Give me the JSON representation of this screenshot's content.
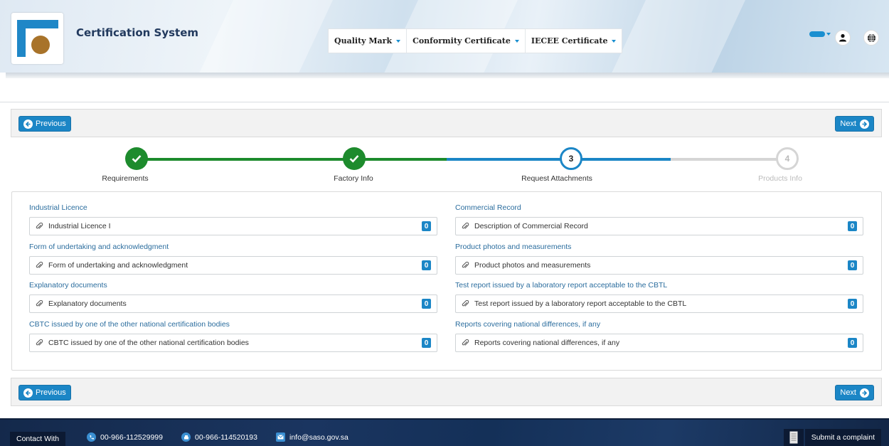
{
  "header": {
    "app_title": "Certification System",
    "nav": [
      {
        "label": "Quality Mark"
      },
      {
        "label": "Conformity Certificate"
      },
      {
        "label": "IECEE Certificate"
      }
    ],
    "icons": {
      "user": "user-icon",
      "language": "globe-icon"
    }
  },
  "pager": {
    "previous_label": "Previous",
    "next_label": "Next"
  },
  "steps": [
    {
      "number": "1",
      "label": "Requirements",
      "state": "done"
    },
    {
      "number": "2",
      "label": "Factory Info",
      "state": "done"
    },
    {
      "number": "3",
      "label": "Request Attachments",
      "state": "active"
    },
    {
      "number": "4",
      "label": "Products Info",
      "state": "todo"
    }
  ],
  "attachments": {
    "left": [
      {
        "label": "Industrial Licence",
        "file": "Industrial Licence I",
        "count": "0"
      },
      {
        "label": "Form of undertaking and acknowledgment",
        "file": "Form of undertaking and acknowledgment",
        "count": "0"
      },
      {
        "label": "Explanatory documents",
        "file": "Explanatory documents",
        "count": "0"
      },
      {
        "label": "CBTC issued by one of the other national certification bodies",
        "file": "CBTC issued by one of the other national certification bodies",
        "count": "0"
      }
    ],
    "right": [
      {
        "label": "Commercial Record",
        "file": "Description of Commercial Record",
        "count": "0"
      },
      {
        "label": "Product photos and measurements",
        "file": "Product photos and measurements",
        "count": "0"
      },
      {
        "label": "Test report issued by a laboratory report acceptable to the CBTL",
        "file": "Test report issued by a laboratory report acceptable to the CBTL",
        "count": "0"
      },
      {
        "label": "Reports covering national differences, if any",
        "file": "Reports covering national differences, if any",
        "count": "0"
      }
    ]
  },
  "footer": {
    "contact_label": "Contact With",
    "phone": "00-966-112529999",
    "fax": "00-966-114520193",
    "email": "info@saso.gov.sa",
    "complaint_label": "Submit a complaint"
  },
  "colors": {
    "primary": "#1b86c6",
    "done": "#1d8b2d",
    "label_blue": "#2b6d9e",
    "footer_dark": "#14294b"
  }
}
